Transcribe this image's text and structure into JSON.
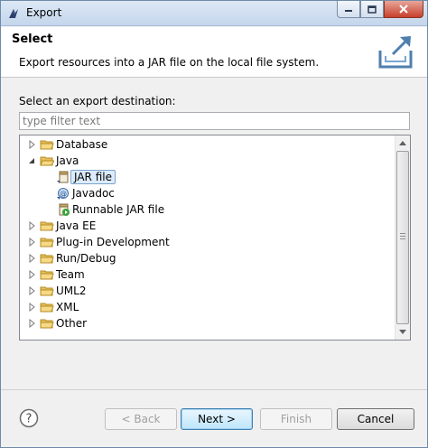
{
  "window": {
    "title": "Export"
  },
  "header": {
    "title": "Select",
    "description": "Export resources into a JAR file on the local file system."
  },
  "body": {
    "destination_label": "Select an export destination:",
    "filter_placeholder": "type filter text"
  },
  "tree": {
    "items": [
      {
        "label": "Database",
        "kind": "folder",
        "expanded": false
      },
      {
        "label": "Java",
        "kind": "folder",
        "expanded": true
      },
      {
        "label": "JAR file",
        "kind": "jar",
        "selected": true
      },
      {
        "label": "Javadoc",
        "kind": "javadoc"
      },
      {
        "label": "Runnable JAR file",
        "kind": "runnable-jar"
      },
      {
        "label": "Java EE",
        "kind": "folder",
        "expanded": false
      },
      {
        "label": "Plug-in Development",
        "kind": "folder",
        "expanded": false
      },
      {
        "label": "Run/Debug",
        "kind": "folder",
        "expanded": false
      },
      {
        "label": "Team",
        "kind": "folder",
        "expanded": false
      },
      {
        "label": "UML2",
        "kind": "folder",
        "expanded": false
      },
      {
        "label": "XML",
        "kind": "folder",
        "expanded": false
      },
      {
        "label": "Other",
        "kind": "folder",
        "expanded": false
      }
    ]
  },
  "buttons": {
    "back": "< Back",
    "next": "Next >",
    "finish": "Finish",
    "cancel": "Cancel"
  },
  "colors": {
    "selection_fill": "#dcebfc",
    "selection_border": "#7da2ce",
    "folder": "#e8c15a"
  }
}
